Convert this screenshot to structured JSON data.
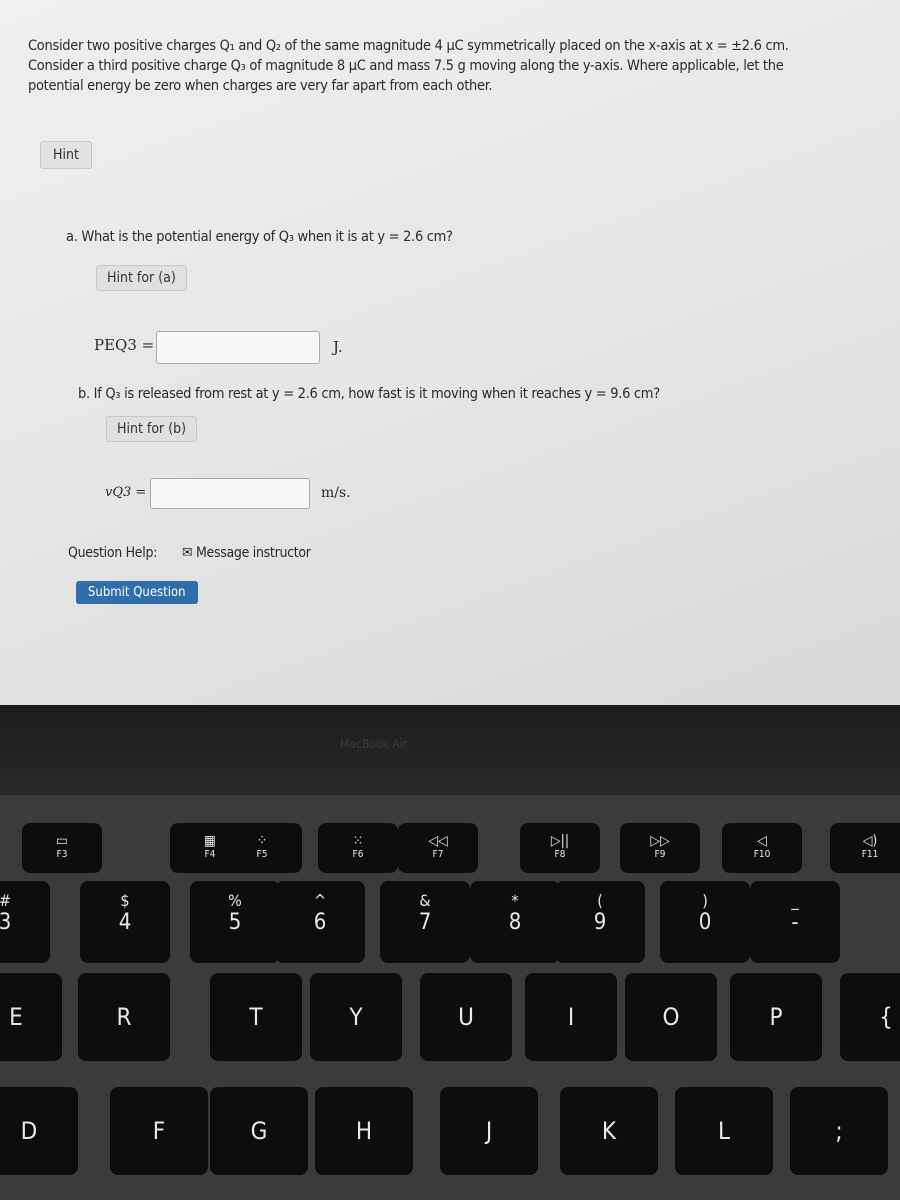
{
  "problem": {
    "intro": "Consider two positive charges Q₁ and Q₂ of the same magnitude 4 μC symmetrically placed on the x-axis at x = ±2.6 cm. Consider a third positive charge Q₃ of magnitude 8 μC and mass 7.5 g moving along the y-axis. Where applicable, let the potential energy be zero when charges are very far apart from each other.",
    "hint": "Hint"
  },
  "part_a": {
    "question": "a. What is the potential energy of Q₃ when it is at y = 2.6 cm?",
    "hint": "Hint for (a)",
    "label": "PEQ3 =",
    "value": "",
    "unit": "J."
  },
  "part_b": {
    "question": "b. If Q₃ is released from rest at y = 2.6 cm, how fast is it moving when it reaches y = 9.6 cm?",
    "hint": "Hint for (b)",
    "label": "vQ3 =",
    "value": "",
    "unit": "m/s."
  },
  "help": {
    "label": "Question Help:",
    "message": "Message instructor",
    "submit": "Submit Question"
  },
  "bezel_label": "MacBook Air",
  "keyboard": {
    "fn": [
      {
        "icon": "mission-control-icon",
        "glyph": "▭",
        "label": "F3"
      },
      {
        "icon": "launchpad-icon",
        "glyph": "▦",
        "label": "F4"
      },
      {
        "icon": "keyboard-brightness-down-icon",
        "glyph": "⁘",
        "label": "F5"
      },
      {
        "icon": "keyboard-brightness-up-icon",
        "glyph": "⁙",
        "label": "F6"
      },
      {
        "icon": "rewind-icon",
        "glyph": "◁◁",
        "label": "F7"
      },
      {
        "icon": "play-pause-icon",
        "glyph": "▷||",
        "label": "F8"
      },
      {
        "icon": "fast-forward-icon",
        "glyph": "▷▷",
        "label": "F9"
      },
      {
        "icon": "mute-icon",
        "glyph": "◁",
        "label": "F10"
      },
      {
        "icon": "volume-down-icon",
        "glyph": "◁)",
        "label": "F11"
      }
    ],
    "num": [
      {
        "top": "#",
        "main": "3"
      },
      {
        "top": "$",
        "main": "4"
      },
      {
        "top": "%",
        "main": "5"
      },
      {
        "top": "^",
        "main": "6"
      },
      {
        "top": "&",
        "main": "7"
      },
      {
        "top": "*",
        "main": "8"
      },
      {
        "top": "(",
        "main": "9"
      },
      {
        "top": ")",
        "main": "0"
      },
      {
        "top": "_",
        "main": "-"
      }
    ],
    "row1": [
      "E",
      "R",
      "T",
      "Y",
      "U",
      "I",
      "O",
      "P",
      "{"
    ],
    "row2": [
      "D",
      "F",
      "G",
      "H",
      "J",
      "K",
      "L",
      ";"
    ]
  }
}
